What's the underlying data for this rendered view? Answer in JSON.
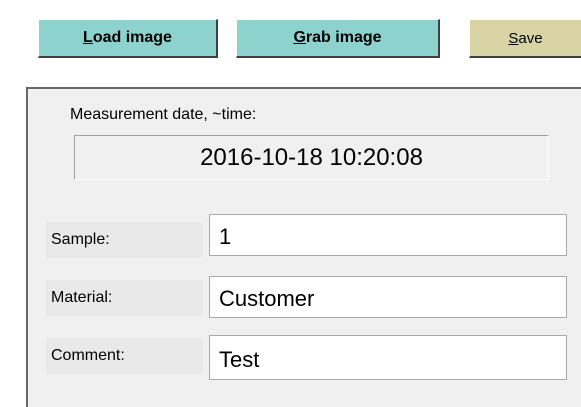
{
  "toolbar": {
    "load_mnemonic": "L",
    "load_rest": "oad image",
    "grab_mnemonic": "G",
    "grab_rest": "rab image",
    "save_mnemonic": "S",
    "save_rest": "ave"
  },
  "measurement": {
    "label": "Measurement date, ~time:",
    "value": "2016-10-18 10:20:08"
  },
  "fields": {
    "sample": {
      "label": "Sample:",
      "value": "1"
    },
    "material": {
      "label": "Material:",
      "value": "Customer"
    },
    "comment": {
      "label": "Comment:",
      "value": "Test"
    }
  },
  "colors": {
    "button_teal": "#8ed2ce",
    "button_save": "#d7d3a3",
    "panel_bg": "#f0f0f0"
  }
}
